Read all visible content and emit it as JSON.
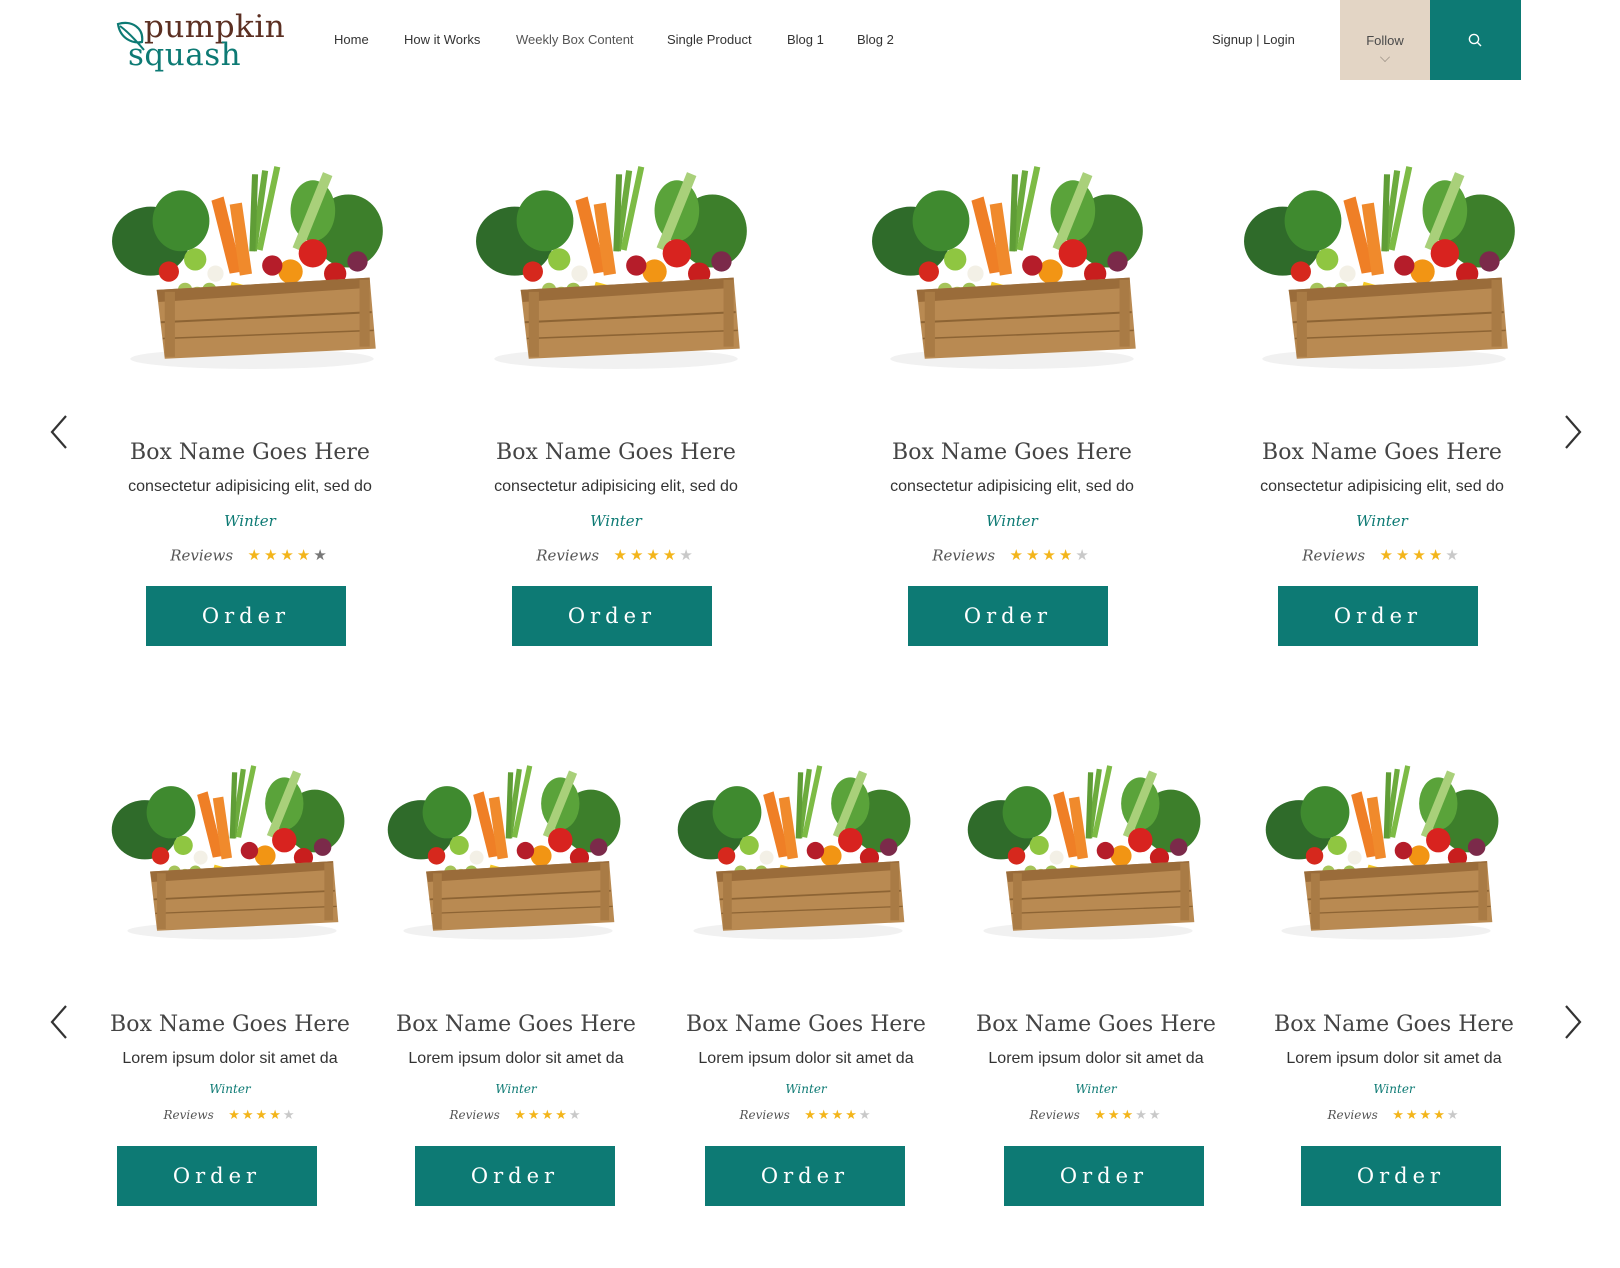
{
  "brand": {
    "line1": "pumpkin",
    "line2": "squash"
  },
  "nav": [
    {
      "label": "Home"
    },
    {
      "label": "How it Works"
    },
    {
      "label": "Weekly Box Content"
    },
    {
      "label": "Single Product"
    },
    {
      "label": "Blog 1"
    },
    {
      "label": "Blog 2"
    }
  ],
  "auth": {
    "label": "Signup | Login"
  },
  "follow": {
    "label": "Follow"
  },
  "colors": {
    "accent": "#0d7a74",
    "brand_brown": "#5b2f22",
    "follow_bg": "#e3d5c5",
    "star": "#f3b51b"
  },
  "row1": {
    "items": [
      {
        "name": "Box Name Goes Here",
        "desc": "consectetur adipisicing elit, sed do",
        "season": "Winter",
        "reviews_label": "Reviews",
        "rating": 4,
        "order_label": "Order"
      },
      {
        "name": "Box Name Goes Here",
        "desc": "consectetur adipisicing elit, sed do",
        "season": "Winter",
        "reviews_label": "Reviews",
        "rating": 4,
        "order_label": "Order"
      },
      {
        "name": "Box Name Goes Here",
        "desc": "consectetur adipisicing elit, sed do",
        "season": "Winter",
        "reviews_label": "Reviews",
        "rating": 4,
        "order_label": "Order"
      },
      {
        "name": "Box Name Goes Here",
        "desc": "consectetur adipisicing elit, sed do",
        "season": "Winter",
        "reviews_label": "Reviews",
        "rating": 4,
        "order_label": "Order"
      }
    ]
  },
  "row2": {
    "items": [
      {
        "name": "Box Name Goes Here",
        "desc": "Lorem ipsum dolor sit amet da",
        "season": "Winter",
        "reviews_label": "Reviews",
        "rating": 4,
        "order_label": "Order"
      },
      {
        "name": "Box Name Goes Here",
        "desc": "Lorem ipsum dolor sit amet da",
        "season": "Winter",
        "reviews_label": "Reviews",
        "rating": 4,
        "order_label": "Order"
      },
      {
        "name": "Box Name Goes Here",
        "desc": "Lorem ipsum dolor sit amet da",
        "season": "Winter",
        "reviews_label": "Reviews",
        "rating": 4,
        "order_label": "Order"
      },
      {
        "name": "Box Name Goes Here",
        "desc": "Lorem ipsum dolor sit amet da",
        "season": "Winter",
        "reviews_label": "Reviews",
        "rating": 3,
        "order_label": "Order"
      },
      {
        "name": "Box Name Goes Here",
        "desc": "Lorem ipsum dolor sit amet da",
        "season": "Winter",
        "reviews_label": "Reviews",
        "rating": 4,
        "order_label": "Order"
      }
    ]
  }
}
